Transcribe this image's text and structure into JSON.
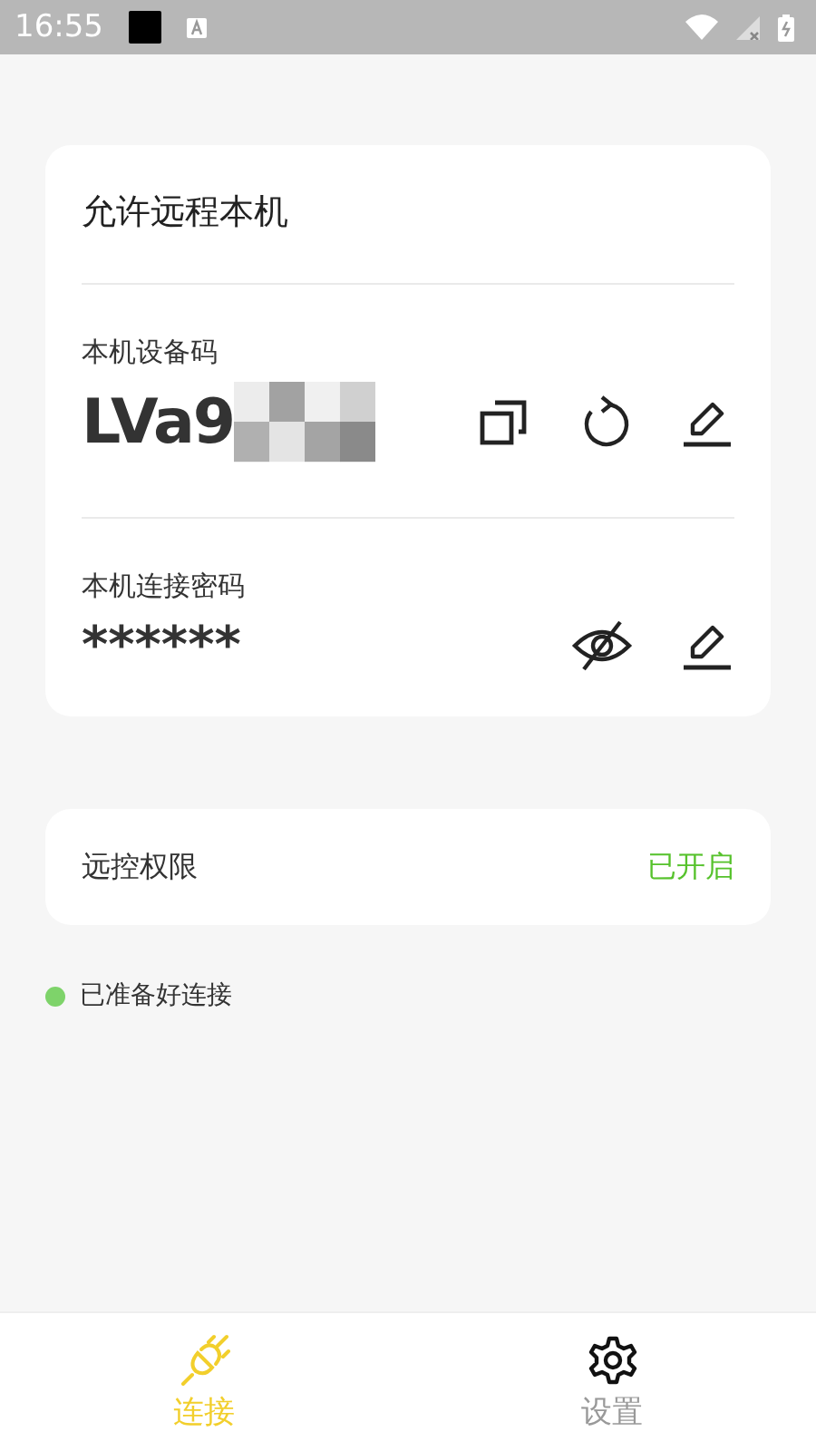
{
  "status_bar": {
    "time": "16:55"
  },
  "card": {
    "title": "允许远程本机",
    "device_code": {
      "label": "本机设备码",
      "value": "LVa9"
    },
    "password": {
      "label": "本机连接密码",
      "value": "******",
      "visible": false
    }
  },
  "remote_permission": {
    "label": "远控权限",
    "status": "已开启"
  },
  "connection_status": {
    "text": "已准备好连接",
    "color": "#7ed36a"
  },
  "tabs": [
    {
      "label": "连接",
      "kind": "connect",
      "selected": true
    },
    {
      "label": "设置",
      "kind": "settings",
      "selected": false
    }
  ]
}
